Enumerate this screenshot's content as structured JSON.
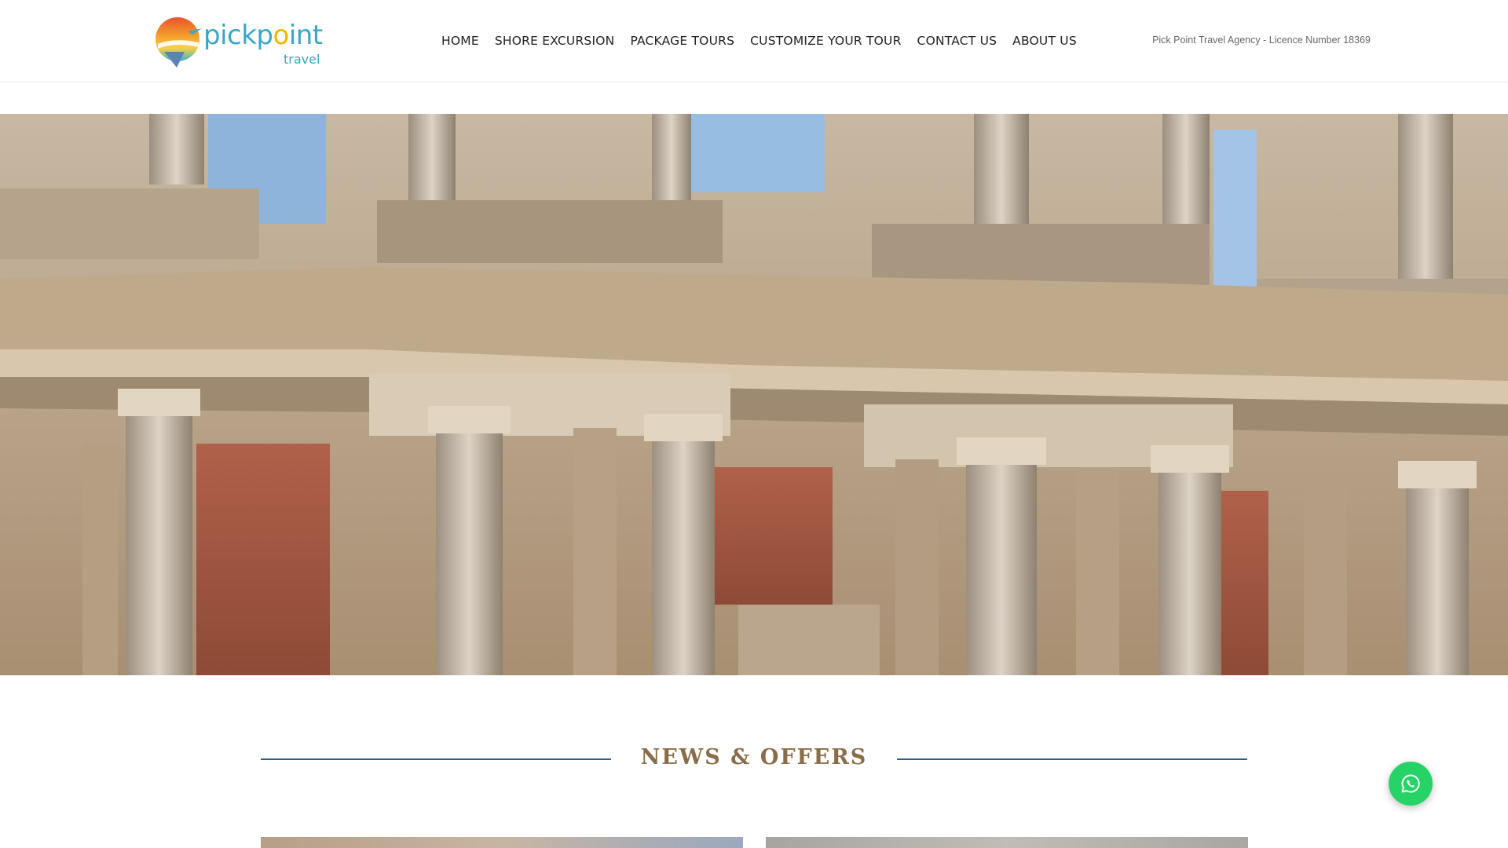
{
  "brand": {
    "name_pick": "pickp",
    "name_o": "o",
    "name_int": "int",
    "sub": "travel"
  },
  "nav": {
    "items": [
      {
        "label": "HOME"
      },
      {
        "label": "SHORE EXCURSION"
      },
      {
        "label": "PACKAGE TOURS"
      },
      {
        "label": "CUSTOMIZE YOUR TOUR"
      },
      {
        "label": "CONTACT US"
      },
      {
        "label": "ABOUT US"
      }
    ]
  },
  "header": {
    "licence": "Pick Point Travel Agency - Licence Number 18369"
  },
  "news": {
    "title": "NEWS & OFFERS"
  },
  "colors": {
    "accent_blue": "#2e5d8a",
    "title_brown": "#8a6d48",
    "whatsapp_green": "#25d366",
    "logo_blue": "#3aa6c8",
    "logo_yellow": "#f4b400"
  },
  "icons": {
    "whatsapp": "whatsapp-icon"
  }
}
